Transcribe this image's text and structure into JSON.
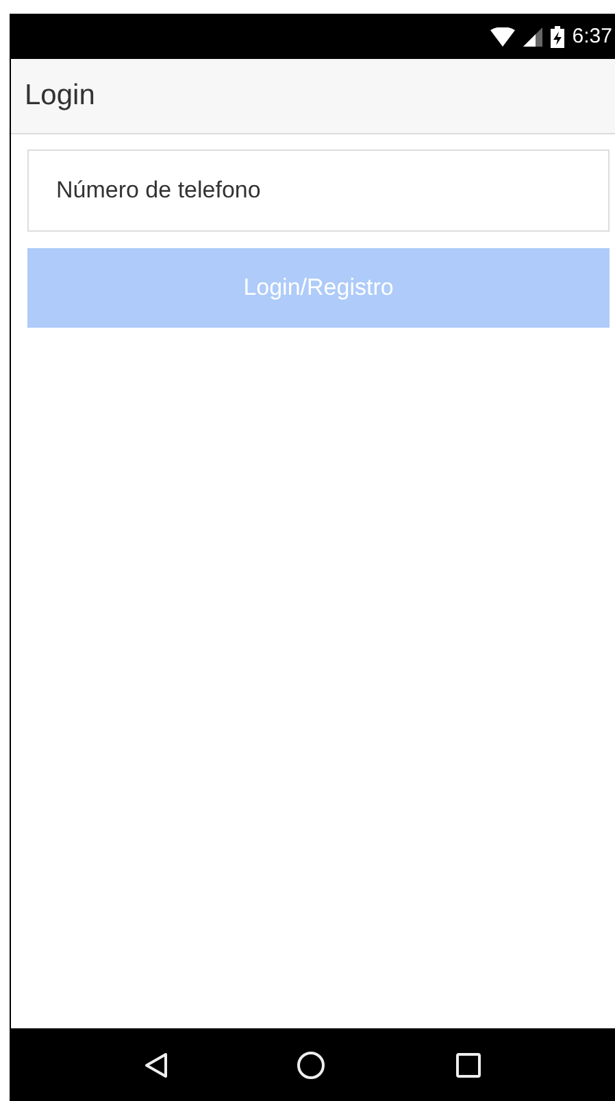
{
  "status_bar": {
    "time": "6:37"
  },
  "app_bar": {
    "title": "Login"
  },
  "phone_field": {
    "placeholder": "Número de telefono"
  },
  "login_button": {
    "label": "Login/Registro",
    "disabled": true
  }
}
